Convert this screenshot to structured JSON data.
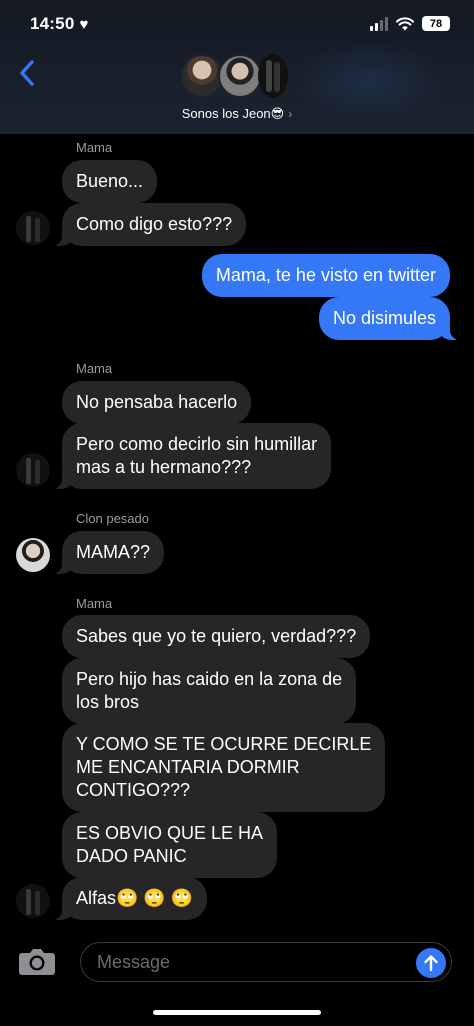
{
  "status": {
    "time": "14:50",
    "battery": "78",
    "icons": [
      "heart-icon",
      "signal-icon",
      "wifi-icon",
      "battery-icon"
    ]
  },
  "header": {
    "group_name": "Sonos los Jeon😎",
    "chevron": "›",
    "back_icon": "chevron-left-icon"
  },
  "messages": [
    {
      "sender": "Mama"
    },
    {
      "text": "Bueno..."
    },
    {
      "text": "Como digo esto???"
    },
    {
      "text": "Mama, te he visto en twitter"
    },
    {
      "text": "No disimules"
    },
    {
      "sender": "Mama"
    },
    {
      "text": "No pensaba hacerlo"
    },
    {
      "line1": "Pero como decirlo sin humillar",
      "line2": "mas a tu hermano???"
    },
    {
      "sender": "Clon pesado"
    },
    {
      "text": "MAMA??"
    },
    {
      "sender": "Mama"
    },
    {
      "text": "Sabes que yo te quiero, verdad???"
    },
    {
      "line1": "Pero hijo has caido en la zona de",
      "line2": "los bros"
    },
    {
      "line1": "Y COMO SE TE OCURRE DECIRLE",
      "line2": "ME ENCANTARIA DORMIR",
      "line3": "CONTIGO???"
    },
    {
      "line1": "ES OBVIO QUE LE HA",
      "line2": "DADO PANIC"
    },
    {
      "text": "Alfas🙄 🙄 🙄"
    }
  ],
  "composer": {
    "placeholder": "Message",
    "camera_icon": "camera-icon",
    "send_icon": "arrow-up-icon"
  },
  "colors": {
    "incoming_bubble": "#262629",
    "outgoing_bubble": "#3478f6",
    "background": "#000000"
  }
}
